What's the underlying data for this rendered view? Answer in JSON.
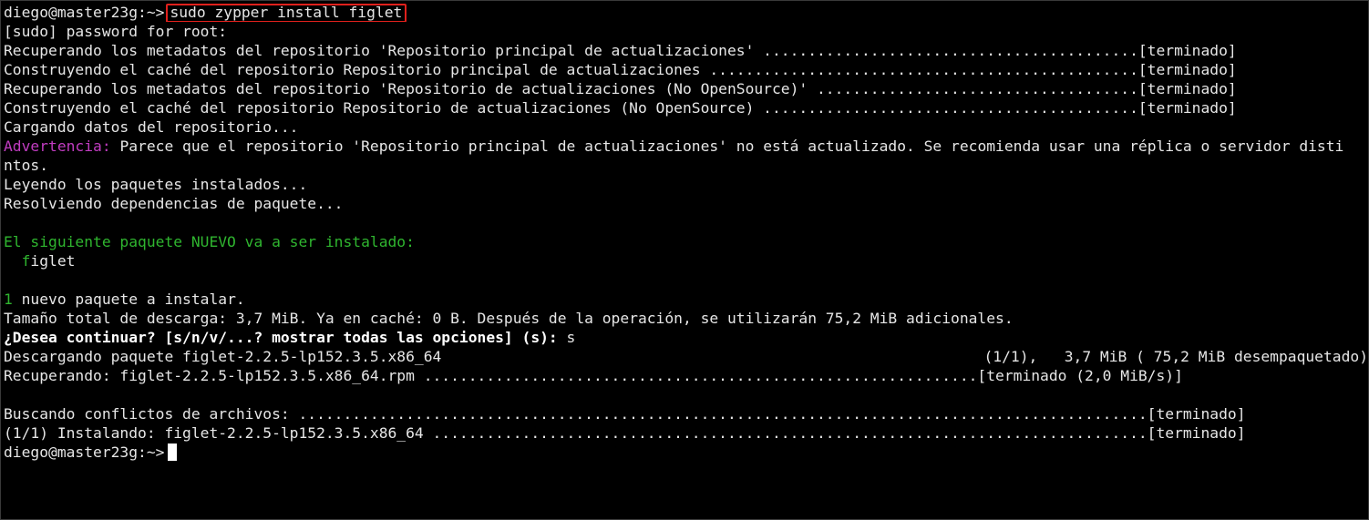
{
  "terminal": {
    "prompt": "diego@master23g:~>",
    "command": "sudo zypper install figlet",
    "lines": [
      "[sudo] password for root:",
      "Recuperando los metadatos del repositorio 'Repositorio principal de actualizaciones' ..........................................[terminado]",
      "Construyendo el caché del repositorio Repositorio principal de actualizaciones ................................................[terminado]",
      "Recuperando los metadatos del repositorio 'Repositorio de actualizaciones (No OpenSource)' ....................................[terminado]",
      "Construyendo el caché del repositorio Repositorio de actualizaciones (No OpenSource) ..........................................[terminado]",
      "Cargando datos del repositorio..."
    ],
    "warning_label": "Advertencia:",
    "warning_text": " Parece que el repositorio 'Repositorio principal de actualizaciones' no está actualizado. Se recomienda usar una réplica o servidor disti",
    "warning_cont": "ntos.",
    "reading": "Leyendo los paquetes instalados...",
    "resolving": "Resolviendo dependencias de paquete...",
    "new_pkg_heading": "El siguiente paquete NUEVO va a ser instalado:",
    "pkg_indent": "  ",
    "pkg_first": "f",
    "pkg_rest": "iglet",
    "count_num": "1",
    "count_text": " nuevo paquete a instalar.",
    "size_line": "Tamaño total de descarga: 3,7 MiB. Ya en caché: 0 B. Después de la operación, se utilizarán 75,2 MiB adicionales.",
    "question": "¿Desea continuar? [s/n/v/...? mostrar todas las opciones] (s):",
    "answer": " s",
    "download_left": "Descargando paquete figlet-2.2.5-lp152.3.5.x86_64",
    "download_right": "(1/1),   3,7 MiB ( 75,2 MiB desempaquetado)",
    "retrieving": "Recuperando: figlet-2.2.5-lp152.3.5.x86_64.rpm ..............................................................[terminado (2,0 MiB/s)]",
    "conflicts": "Buscando conflictos de archivos: ...............................................................................................[terminado]",
    "installing": "(1/1) Instalando: figlet-2.2.5-lp152.3.5.x86_64 ................................................................................[terminado]",
    "final_prompt": "diego@master23g:~>"
  },
  "colors": {
    "background": "#000000",
    "text": "#e6e6e6",
    "highlight_box": "#e0201c",
    "warning": "#c03cc0",
    "success": "#2fb52f"
  }
}
